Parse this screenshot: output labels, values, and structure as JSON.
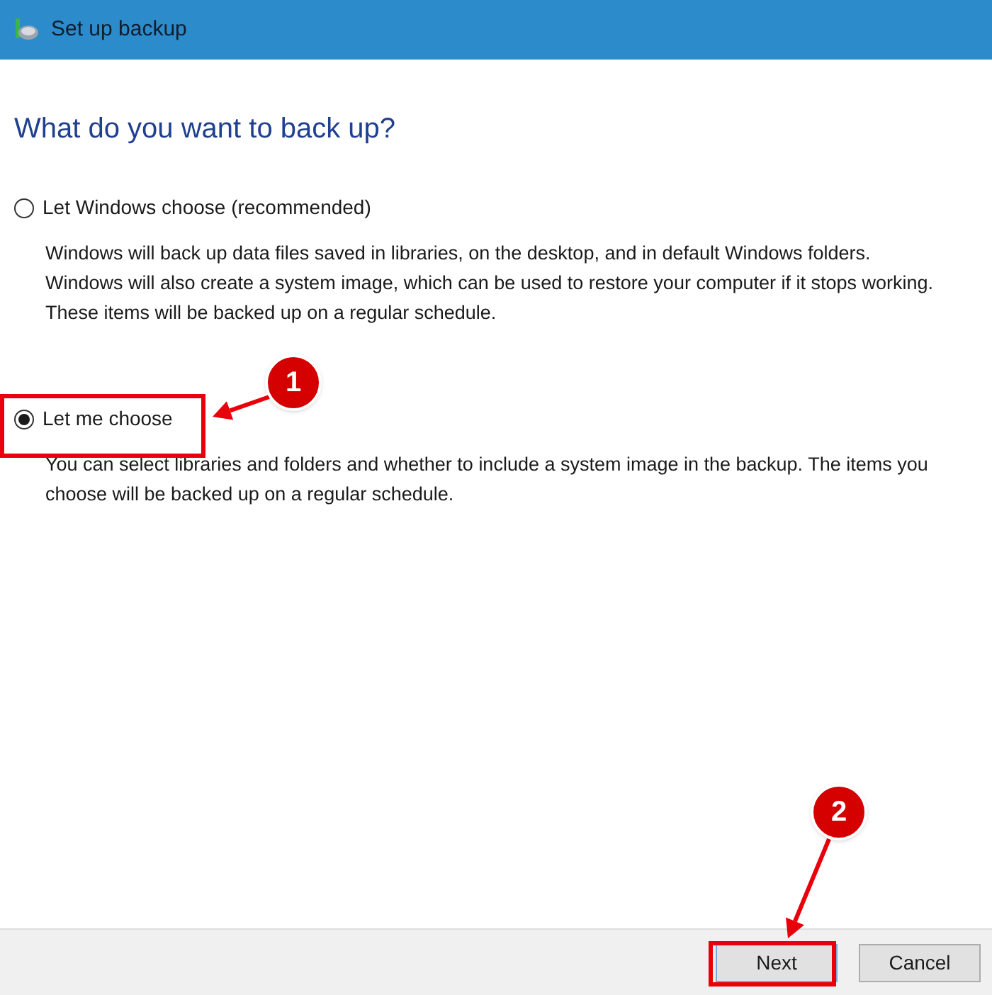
{
  "window": {
    "title": "Set up backup"
  },
  "heading": "What do you want to back up?",
  "options": [
    {
      "label": "Let Windows choose (recommended)",
      "selected": false,
      "description": "Windows will back up data files saved in libraries, on the desktop, and in default Windows folders. Windows will also create a system image, which can be used to restore your computer if it stops working. These items will be backed up on a regular schedule."
    },
    {
      "label": "Let me choose",
      "selected": true,
      "description": "You can select libraries and folders and whether to include a system image in the backup. The items you choose will be backed up on a regular schedule."
    }
  ],
  "buttons": [
    {
      "label": "Next",
      "kind": "primary"
    },
    {
      "label": "Cancel",
      "kind": "normal"
    }
  ],
  "annotations": [
    {
      "number": "1"
    },
    {
      "number": "2"
    }
  ]
}
